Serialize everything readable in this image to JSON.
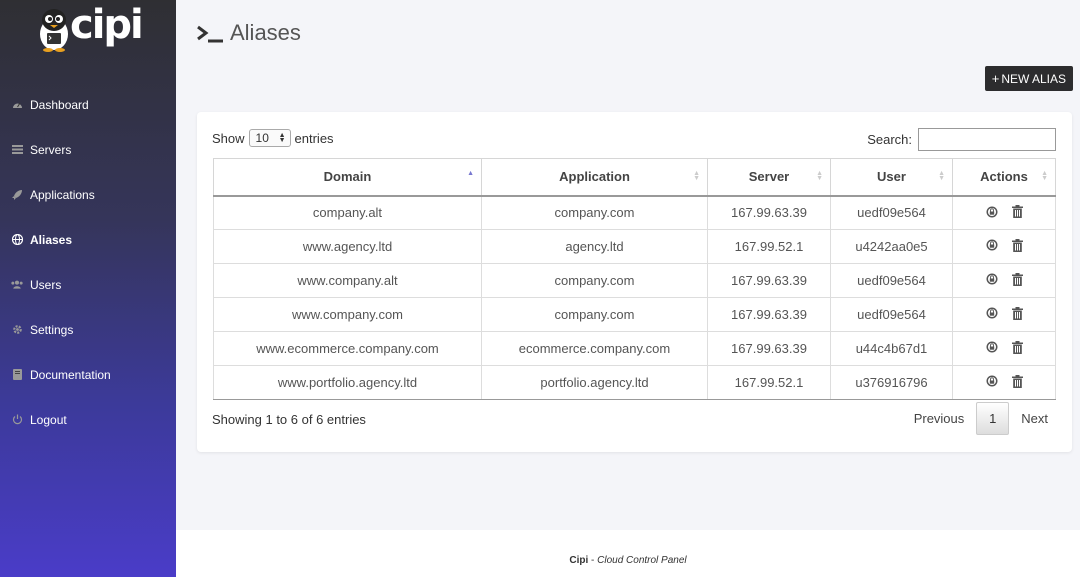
{
  "app": {
    "logo_text": "cipi"
  },
  "sidebar": {
    "items": [
      {
        "label": "Dashboard",
        "icon": "dashboard-icon"
      },
      {
        "label": "Servers",
        "icon": "server-icon"
      },
      {
        "label": "Applications",
        "icon": "rocket-icon"
      },
      {
        "label": "Aliases",
        "icon": "globe-icon",
        "active": true
      },
      {
        "label": "Users",
        "icon": "users-icon"
      },
      {
        "label": "Settings",
        "icon": "gear-icon"
      },
      {
        "label": "Documentation",
        "icon": "book-icon"
      },
      {
        "label": "Logout",
        "icon": "power-icon"
      }
    ]
  },
  "page": {
    "title": "Aliases",
    "new_button": "NEW ALIAS"
  },
  "table_controls": {
    "show_label": "Show",
    "entries_value": "10",
    "entries_label": "entries",
    "search_label": "Search:"
  },
  "table": {
    "columns": [
      "Domain",
      "Application",
      "Server",
      "User",
      "Actions"
    ],
    "rows": [
      {
        "domain": "company.alt",
        "application": "company.com",
        "server": "167.99.63.39",
        "user": "uedf09e564"
      },
      {
        "domain": "www.agency.ltd",
        "application": "agency.ltd",
        "server": "167.99.52.1",
        "user": "u4242aa0e5"
      },
      {
        "domain": "www.company.alt",
        "application": "company.com",
        "server": "167.99.63.39",
        "user": "uedf09e564"
      },
      {
        "domain": "www.company.com",
        "application": "company.com",
        "server": "167.99.63.39",
        "user": "uedf09e564"
      },
      {
        "domain": "www.ecommerce.company.com",
        "application": "ecommerce.company.com",
        "server": "167.99.63.39",
        "user": "u44c4b67d1"
      },
      {
        "domain": "www.portfolio.agency.ltd",
        "application": "portfolio.agency.ltd",
        "server": "167.99.52.1",
        "user": "u376916796"
      }
    ]
  },
  "pagination": {
    "info": "Showing 1 to 6 of 6 entries",
    "previous": "Previous",
    "current": "1",
    "next": "Next"
  },
  "footer": {
    "brand": "Cipi",
    "separator": " - ",
    "tagline": "Cloud Control Panel"
  }
}
